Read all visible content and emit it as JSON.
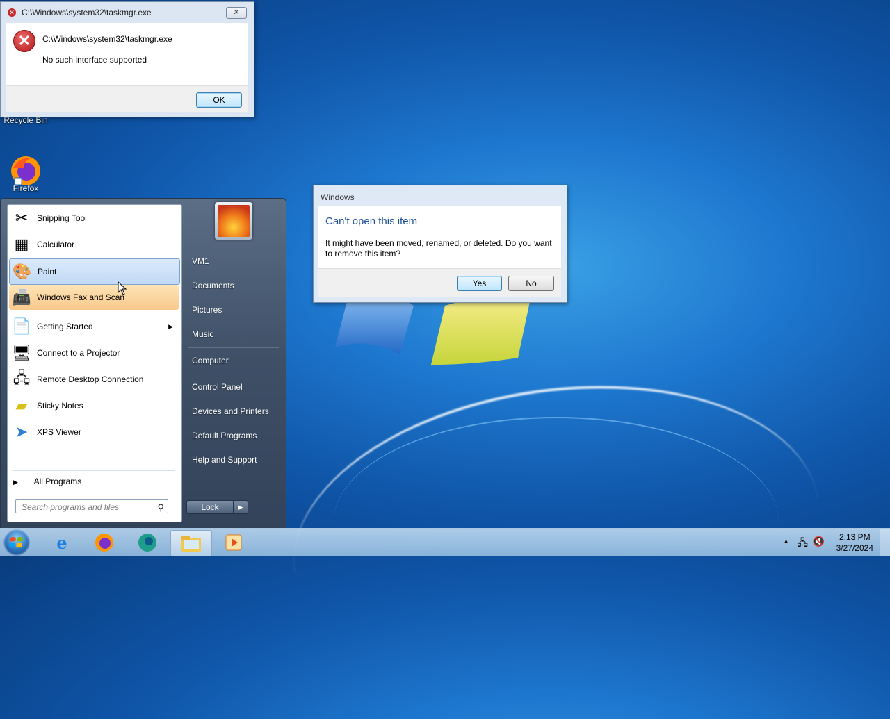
{
  "desktop": {
    "icons": [
      {
        "label": "Recycle Bin"
      },
      {
        "label": "Firefox"
      }
    ]
  },
  "error_dialog": {
    "title": "C:\\Windows\\system32\\taskmgr.exe",
    "path_text": "C:\\Windows\\system32\\taskmgr.exe",
    "message": "No such interface supported",
    "ok_label": "OK",
    "close_label": "✕"
  },
  "windows_dialog": {
    "title": "Windows",
    "heading": "Can't open this item",
    "message": "It might have been moved, renamed, or deleted. Do you want to remove this item?",
    "yes_label": "Yes",
    "no_label": "No"
  },
  "start_menu": {
    "programs": [
      {
        "label": "Snipping Tool",
        "icon": "scissors-icon"
      },
      {
        "label": "Calculator",
        "icon": "calculator-icon"
      },
      {
        "label": "Paint",
        "icon": "paint-palette-icon"
      },
      {
        "label": "Windows Fax and Scan",
        "icon": "fax-icon"
      },
      {
        "label": "Getting Started",
        "icon": "getting-started-icon"
      },
      {
        "label": "Connect to a Projector",
        "icon": "projector-icon"
      },
      {
        "label": "Remote Desktop Connection",
        "icon": "remote-desktop-icon"
      },
      {
        "label": "Sticky Notes",
        "icon": "sticky-notes-icon"
      },
      {
        "label": "XPS Viewer",
        "icon": "xps-viewer-icon"
      }
    ],
    "all_programs": "All Programs",
    "search_placeholder": "Search programs and files",
    "right_items": {
      "user": "VM1",
      "documents": "Documents",
      "pictures": "Pictures",
      "music": "Music",
      "computer": "Computer",
      "control_panel": "Control Panel",
      "devices": "Devices and Printers",
      "default_programs": "Default Programs",
      "help": "Help and Support"
    },
    "lock_label": "Lock"
  },
  "taskbar": {
    "pinned": [
      "internet-explorer-icon",
      "firefox-icon",
      "edge-icon",
      "file-explorer-icon",
      "media-player-icon"
    ],
    "time": "2:13 PM",
    "date": "3/27/2024"
  }
}
